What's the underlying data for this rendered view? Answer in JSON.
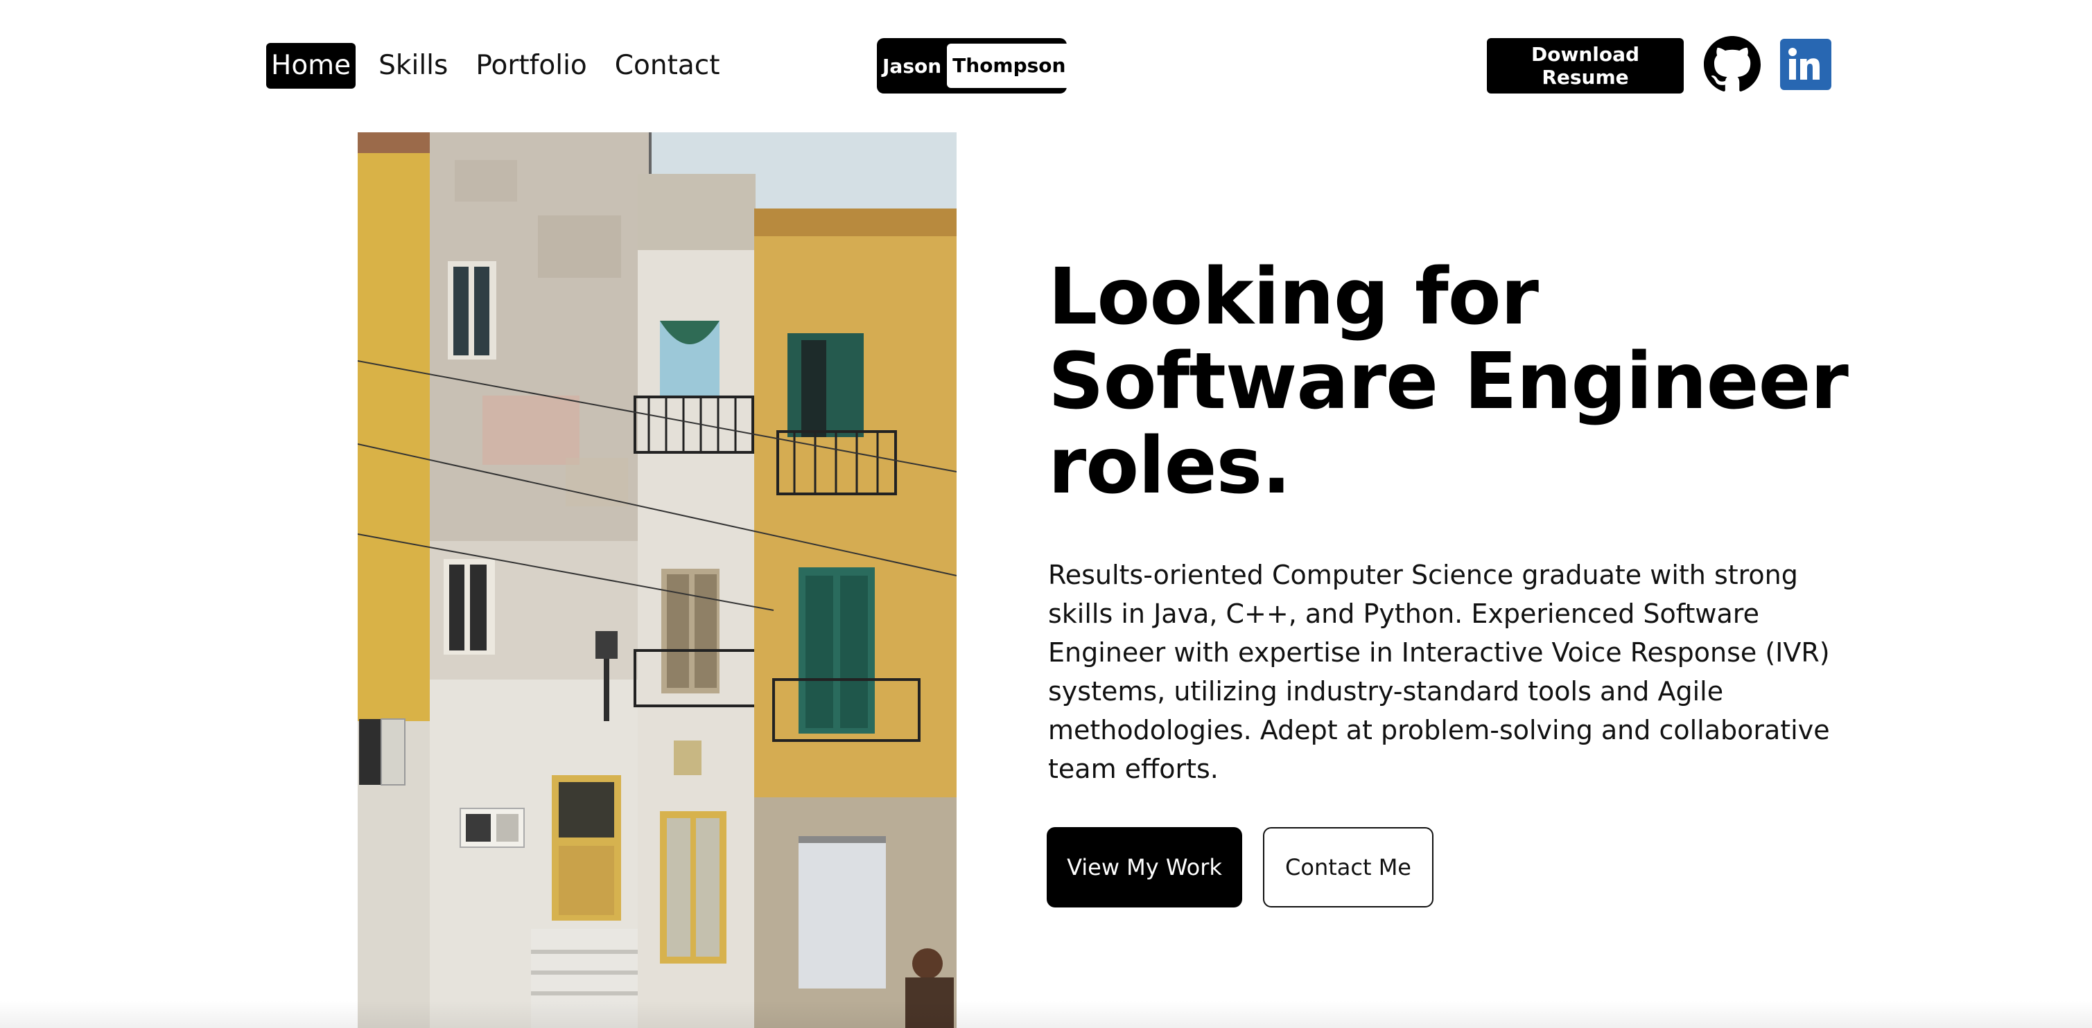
{
  "nav": {
    "links": [
      {
        "label": "Home",
        "active": true
      },
      {
        "label": "Skills",
        "active": false
      },
      {
        "label": "Portfolio",
        "active": false
      },
      {
        "label": "Contact",
        "active": false
      }
    ],
    "brand": {
      "first_name": "Jason",
      "last_name": "Thompson"
    },
    "resume_button": "Download Resume",
    "social": [
      {
        "icon": "github-icon"
      },
      {
        "icon": "linkedin-icon"
      }
    ]
  },
  "hero": {
    "headline": "Looking for Software Engineer roles.",
    "description": "Results-oriented Computer Science graduate with strong skills in Java, C++, and Python. Experienced Software Engineer with expertise in Interactive Voice Response (IVR) systems, utilizing industry-standard tools and Agile methodologies. Adept at problem-solving and collaborative team efforts.",
    "primary_button": "View My Work",
    "secondary_button": "Contact Me"
  },
  "colors": {
    "accent": "#000000",
    "background": "#ffffff",
    "linkedin": "#2867b2"
  }
}
